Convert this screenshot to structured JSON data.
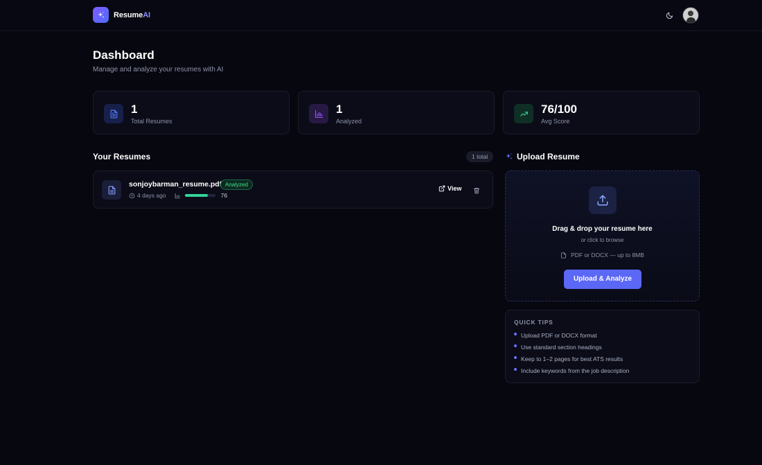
{
  "app": {
    "name": "Resume",
    "name_accent": "AI"
  },
  "header": {
    "title": "Dashboard",
    "subtitle": "Manage and analyze your resumes with AI"
  },
  "stats": [
    {
      "value": "1",
      "label": "Total Resumes",
      "icon": "document-icon",
      "color": "#5b7cff"
    },
    {
      "value": "1",
      "label": "Analyzed",
      "icon": "bar-chart-icon",
      "color": "#a05bff"
    },
    {
      "value": "76/100",
      "label": "Avg Score",
      "icon": "trending-up-icon",
      "color": "#34d399"
    }
  ],
  "resumes": {
    "title": "Your Resumes",
    "count_label": "1 total",
    "items": [
      {
        "filename": "sonjoybarman_resume.pdf",
        "status": "Analyzed",
        "time": "4 days ago",
        "score": 76,
        "score_fraction": 0.76,
        "view_label": "View"
      }
    ]
  },
  "upload": {
    "title": "Upload Resume",
    "drop_title": "Drag & drop your resume here",
    "drop_sub": "or click to browse",
    "format_hint": "PDF or DOCX — up to 8MB",
    "button_label": "Upload & Analyze"
  },
  "tips": {
    "title": "QUICK TIPS",
    "items": [
      "Upload PDF or DOCX format",
      "Use standard section headings",
      "Keep to 1–2 pages for best ATS results",
      "Include keywords from the job description"
    ]
  },
  "colors": {
    "accent": "#5b67f5",
    "success": "#34d399",
    "background": "#070710"
  }
}
